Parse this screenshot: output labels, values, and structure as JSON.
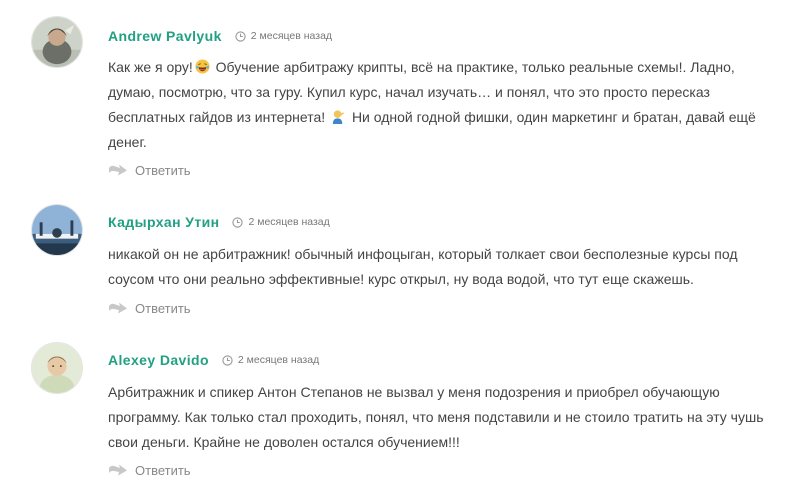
{
  "comments": [
    {
      "author": "Andrew Pavlyuk",
      "date": "2 месяцев назад",
      "lines": [
        "Как же я ору!",
        "Обучение арбитражу крипты, всё на практике, только реальные схемы!. Ладно,",
        "думаю, посмотрю, что за гуру. Купил курс, начал изучать… и понял, что это просто пересказ",
        "бесплатных гайдов из интернета!",
        "Ни одной годной фишки, один маркетинг и братан, давай ещё",
        "денег."
      ],
      "reply_label": "Ответить",
      "emoji_icons": [
        "laughing-emoji-icon",
        "facepalm-emoji-icon"
      ]
    },
    {
      "author": "Кадырхан Утин",
      "date": "2 месяцев назад",
      "lines": [
        "никакой он не арбитражник! обычный инфоцыган, который толкает свои бесполезные курсы под",
        "соусом что они реально эффективные! курс открыл, ну вода водой, что тут еще скажешь."
      ],
      "reply_label": "Ответить"
    },
    {
      "author": "Alexey Davido",
      "date": "2 месяцев назад",
      "lines": [
        "Арбитражник и спикер Антон Степанов не вызвал у меня подозрения и приобрел обучающую",
        "программу. Как только стал проходить, понял, что меня подставили и не стоило тратить на эту чушь",
        "свои деньги. Крайне не доволен остался обучением!!!"
      ],
      "reply_label": "Ответить"
    }
  ],
  "colors": {
    "author": "#21a083",
    "text": "#444444",
    "muted": "#888888"
  },
  "icons": [
    "avatar",
    "clock-icon",
    "reply-arrow-icon"
  ]
}
